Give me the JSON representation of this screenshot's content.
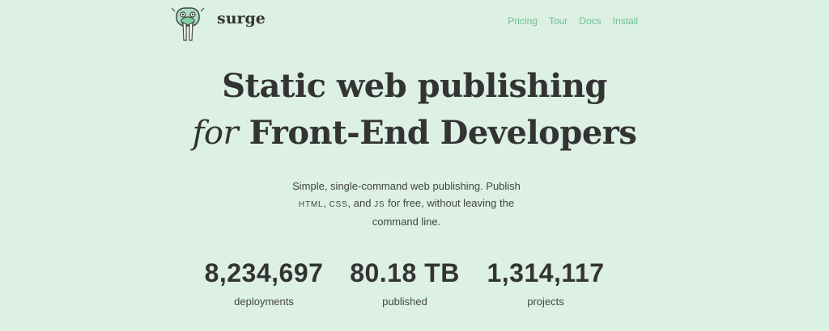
{
  "brand": {
    "name": "surge",
    "logo_icon": "walrus-logo-icon"
  },
  "nav": {
    "items": [
      "Pricing",
      "Tour",
      "Docs",
      "Install"
    ]
  },
  "hero": {
    "line1": "Static web publishing",
    "line2_italic": "for",
    "line2_rest": "Front-End Developers"
  },
  "intro": {
    "part1": "Simple, single-command web publishing. Publish",
    "html": "HTML",
    "sep1": ", ",
    "css": "CSS",
    "sep2": ", and ",
    "js": "JS",
    "part2": " for free, without leaving the",
    "part3": "command line."
  },
  "stats": [
    {
      "value": "8,234,697",
      "label": "deployments"
    },
    {
      "value": "80.18 TB",
      "label": "published"
    },
    {
      "value": "1,314,117",
      "label": "projects"
    }
  ],
  "colors": {
    "background": "#dcf0e4",
    "accent": "#6cbf90",
    "text": "#333333"
  }
}
